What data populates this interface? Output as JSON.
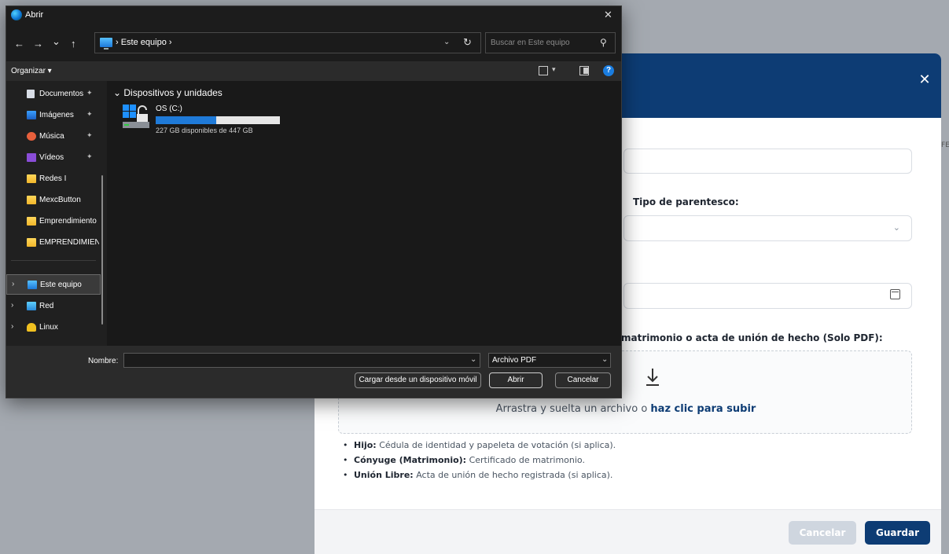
{
  "dialog": {
    "title": "Abrir",
    "close_glyph": "✕",
    "nav": {
      "back": "←",
      "forward": "→",
      "recent": "⌄",
      "up": "↑"
    },
    "address": "› Este equipo ›",
    "address_drop": "⌄",
    "refresh": "↻",
    "search_placeholder": "Buscar en Este equipo",
    "organize": "Organizar ▾",
    "sidebar": [
      {
        "label": "Documentos",
        "icon": "document-icon",
        "pinned": true
      },
      {
        "label": "Imágenes",
        "icon": "pictures-icon",
        "pinned": true
      },
      {
        "label": "Música",
        "icon": "music-icon",
        "pinned": true
      },
      {
        "label": "Vídeos",
        "icon": "videos-icon",
        "pinned": true
      },
      {
        "label": "Redes I",
        "icon": "folder-icon",
        "pinned": false
      },
      {
        "label": "MexcButton",
        "icon": "folder-icon",
        "pinned": false
      },
      {
        "label": "Emprendimiento",
        "icon": "folder-icon",
        "pinned": false
      },
      {
        "label": "EMPRENDIMIENTO",
        "icon": "folder-icon",
        "pinned": false
      },
      {
        "label": "Este equipo",
        "icon": "computer-icon",
        "selected": true
      },
      {
        "label": "Red",
        "icon": "network-icon"
      },
      {
        "label": "Linux",
        "icon": "linux-icon"
      }
    ],
    "group_header": "Dispositivos y unidades",
    "drive": {
      "name": "OS (C:)",
      "info": "227 GB disponibles de 447 GB",
      "used_fraction": 0.49
    },
    "filename_label": "Nombre:",
    "filename_value": "",
    "file_type": "Archivo PDF",
    "buttons": {
      "mobile": "Cargar desde un dispositivo móvil",
      "open": "Abrir",
      "cancel": "Cancelar"
    }
  },
  "modal": {
    "close_glyph": "✕",
    "kinship_label": "Tipo de parentesco:",
    "document_label": "matrimonio o acta de unión de hecho (Solo PDF):",
    "drop_text_prefix": "Arrastra y suelta un archivo o ",
    "drop_text_link": "haz clic para subir",
    "notes": [
      {
        "title": "Hijo:",
        "text": " Cédula de identidad y papeleta de votación (si aplica)."
      },
      {
        "title": "Cónyuge (Matrimonio):",
        "text": " Certificado de matrimonio."
      },
      {
        "title": "Unión Libre:",
        "text": " Acta de unión de hecho registrada (si aplica)."
      }
    ],
    "cancel": "Cancelar",
    "save": "Guardar"
  },
  "colors": {
    "modal_header": "#0d3c74",
    "primary_button": "#0d3c74",
    "dialog_bg": "#202020",
    "drive_bar": "#1f7ad8"
  }
}
